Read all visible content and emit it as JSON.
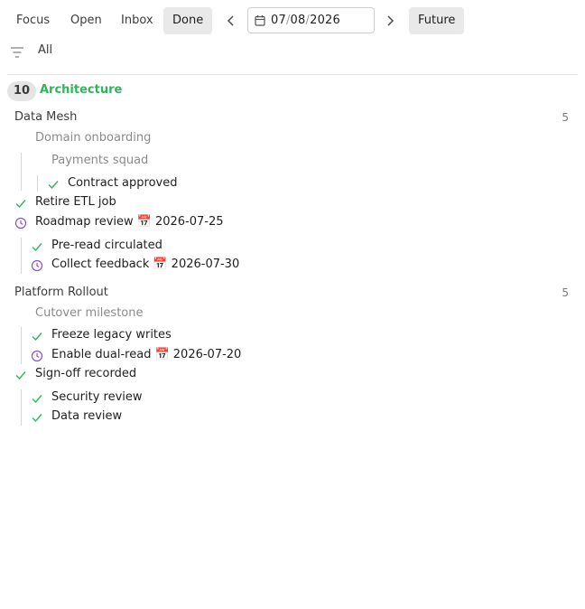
{
  "tabs": [
    {
      "label": "Focus",
      "active": false
    },
    {
      "label": "Open",
      "active": false
    },
    {
      "label": "Inbox",
      "active": false
    },
    {
      "label": "Done",
      "active": true
    }
  ],
  "date": {
    "month": "07",
    "day": "08",
    "year": "2026"
  },
  "future_label": "Future",
  "filter": {
    "label": "All"
  },
  "group": {
    "count": "10",
    "title": "Architecture",
    "color": "#2fb55a"
  },
  "sections": [
    {
      "title": "Data Mesh",
      "count": "5",
      "headings": [
        "Domain onboarding",
        "Payments squad"
      ],
      "tasks": [
        {
          "text": "Contract approved",
          "status": "done"
        },
        {
          "text": "Retire ETL job",
          "status": "done"
        },
        {
          "text": "Roadmap review",
          "status": "scheduled",
          "due": "📅 2026-07-25"
        },
        {
          "text": "Pre-read circulated",
          "status": "done"
        },
        {
          "text": "Collect feedback",
          "status": "scheduled",
          "due": "📅 2026-07-30"
        }
      ]
    },
    {
      "title": "Platform Rollout",
      "count": "5",
      "headings": [
        "Cutover milestone"
      ],
      "tasks": [
        {
          "text": "Freeze legacy writes",
          "status": "done"
        },
        {
          "text": "Enable dual-read",
          "status": "scheduled",
          "due": "📅 2026-07-20"
        },
        {
          "text": "Sign-off recorded",
          "status": "done"
        },
        {
          "text": "Security review",
          "status": "done"
        },
        {
          "text": "Data review",
          "status": "done"
        }
      ]
    }
  ],
  "colors": {
    "done_check": "#2fb55a",
    "scheduled_clock": "#8a4fd6",
    "group_title": "#2fb55a"
  },
  "icons": {
    "done": "check-icon",
    "scheduled": "clock-icon",
    "filter": "filter-icon",
    "date": "calendar-icon"
  }
}
